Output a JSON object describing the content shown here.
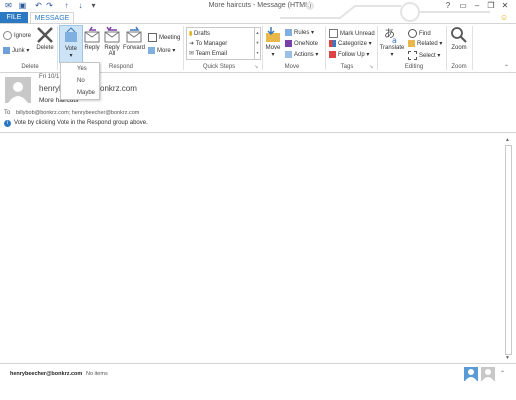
{
  "window": {
    "title": "More haircuts - Message (HTML)",
    "help": "?",
    "smiley": "☺"
  },
  "tabs": {
    "file": "FILE",
    "message": "MESSAGE"
  },
  "ribbon": {
    "delete_group": {
      "label": "Delete",
      "ignore": "Ignore",
      "junk": "Junk",
      "delete": "Delete"
    },
    "respond_group": {
      "label": "Respond",
      "vote": "Vote",
      "reply": "Reply",
      "reply_all": "Reply All",
      "forward": "Forward",
      "meeting": "Meeting",
      "more": "More"
    },
    "quick_steps": {
      "label": "Quick Steps",
      "items": [
        "Drafts",
        "To Manager",
        "Team Email"
      ]
    },
    "move_group": {
      "label": "Move",
      "move": "Move",
      "rules": "Rules",
      "onenote": "OneNote",
      "actions": "Actions"
    },
    "tags_group": {
      "label": "Tags",
      "mark_unread": "Mark Unread",
      "categorize": "Categorize",
      "follow_up": "Follow Up"
    },
    "editing_group": {
      "label": "Editing",
      "translate": "Translate",
      "find": "Find",
      "related": "Related",
      "select": "Select"
    },
    "zoom_group": {
      "label": "Zoom",
      "zoom": "Zoom"
    }
  },
  "vote_menu": {
    "options": [
      "Yes",
      "No",
      "Maybe"
    ]
  },
  "message": {
    "date": "Fri 10/1",
    "sender": "henryb",
    "sender_rest": "onkrz.com",
    "subject": "More haircuts",
    "to_label": "To",
    "recipients": "billybob@bonkrz.com; henrybeecher@bonkrz.com",
    "info": "Vote by clicking Vote in the Respond group above."
  },
  "footer": {
    "email": "henrybeecher@bonkrz.com",
    "status": "No items"
  },
  "colors": {
    "accent": "#2b79c2",
    "file_tab": "#2b79c2"
  }
}
